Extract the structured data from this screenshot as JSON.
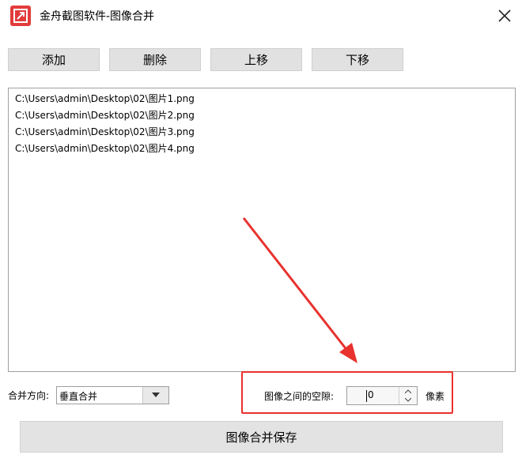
{
  "window": {
    "title": "金舟截图软件-图像合并"
  },
  "toolbar": {
    "add_label": "添加",
    "delete_label": "删除",
    "up_label": "上移",
    "down_label": "下移"
  },
  "file_list": [
    "C:\\Users\\admin\\Desktop\\02\\图片1.png",
    "C:\\Users\\admin\\Desktop\\02\\图片2.png",
    "C:\\Users\\admin\\Desktop\\02\\图片3.png",
    "C:\\Users\\admin\\Desktop\\02\\图片4.png"
  ],
  "merge": {
    "direction_label": "合并方向:",
    "direction_value": "垂直合并",
    "gap_label": "图像之间的空隙:",
    "gap_value": "0",
    "gap_unit": "像素"
  },
  "save_label": "图像合并保存",
  "colors": {
    "annotation": "#e8322e",
    "app_icon": "#e23b3b"
  }
}
